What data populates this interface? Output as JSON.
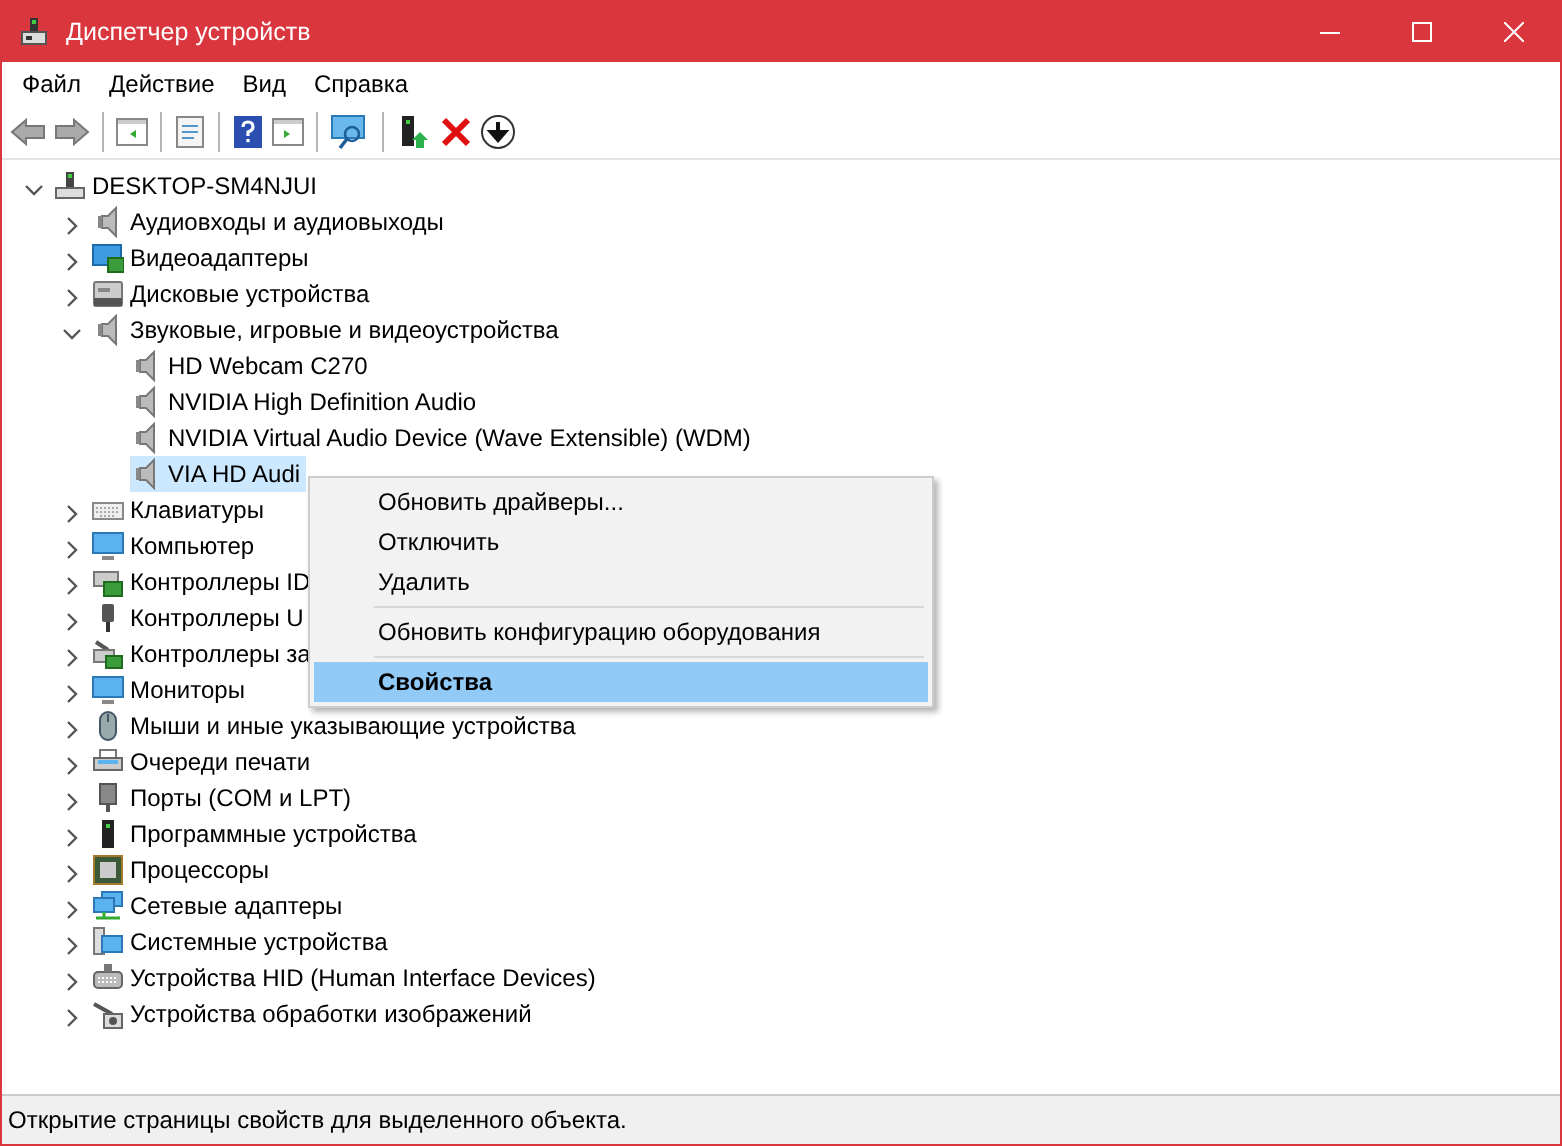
{
  "window": {
    "title": "Диспетчер устройств"
  },
  "menu_bar": [
    "Файл",
    "Действие",
    "Вид",
    "Справка"
  ],
  "tree": {
    "label": "DESKTOP-SM4NJUI",
    "kind": "computer",
    "expanded": true,
    "selected": false,
    "children": [
      {
        "label": "Аудиовходы и аудиовыходы",
        "kind": "speaker",
        "expanded": false,
        "selected": false
      },
      {
        "label": "Видеоадаптеры",
        "kind": "display",
        "expanded": false,
        "selected": false
      },
      {
        "label": "Дисковые устройства",
        "kind": "disk",
        "expanded": false,
        "selected": false
      },
      {
        "label": "Звуковые, игровые и видеоустройства",
        "kind": "speaker",
        "expanded": true,
        "selected": false,
        "children": [
          {
            "label": "HD Webcam C270",
            "kind": "speaker",
            "selected": false
          },
          {
            "label": "NVIDIA High Definition Audio",
            "kind": "speaker",
            "selected": false
          },
          {
            "label": "NVIDIA Virtual Audio Device (Wave Extensible) (WDM)",
            "kind": "speaker",
            "selected": false
          },
          {
            "label": "VIA HD Audi",
            "kind": "speaker",
            "selected": true
          }
        ]
      },
      {
        "label": "Клавиатуры",
        "kind": "keyboard",
        "expanded": false,
        "selected": false
      },
      {
        "label": "Компьютер",
        "kind": "monitor",
        "expanded": false,
        "selected": false
      },
      {
        "label": "Контроллеры ID",
        "kind": "controller",
        "expanded": false,
        "selected": false
      },
      {
        "label": "Контроллеры U",
        "kind": "usb",
        "expanded": false,
        "selected": false
      },
      {
        "label": "Контроллеры за",
        "kind": "storage",
        "expanded": false,
        "selected": false
      },
      {
        "label": "Мониторы",
        "kind": "monitor",
        "expanded": false,
        "selected": false
      },
      {
        "label": "Мыши и иные указывающие устройства",
        "kind": "mouse",
        "expanded": false,
        "selected": false
      },
      {
        "label": "Очереди печати",
        "kind": "printer",
        "expanded": false,
        "selected": false
      },
      {
        "label": "Порты (COM и LPT)",
        "kind": "port",
        "expanded": false,
        "selected": false
      },
      {
        "label": "Программные устройства",
        "kind": "software",
        "expanded": false,
        "selected": false
      },
      {
        "label": "Процессоры",
        "kind": "cpu",
        "expanded": false,
        "selected": false
      },
      {
        "label": "Сетевые адаптеры",
        "kind": "network",
        "expanded": false,
        "selected": false
      },
      {
        "label": "Системные устройства",
        "kind": "system",
        "expanded": false,
        "selected": false
      },
      {
        "label": "Устройства HID (Human Interface Devices)",
        "kind": "hid",
        "expanded": false,
        "selected": false
      },
      {
        "label": "Устройства обработки изображений",
        "kind": "camera",
        "expanded": false,
        "selected": false
      }
    ]
  },
  "context_menu": [
    {
      "kind": "item",
      "label": "Обновить драйверы...",
      "selected": false
    },
    {
      "kind": "item",
      "label": "Отключить",
      "selected": false
    },
    {
      "kind": "item",
      "label": "Удалить",
      "selected": false
    },
    {
      "kind": "separator"
    },
    {
      "kind": "item",
      "label": "Обновить конфигурацию оборудования",
      "selected": false
    },
    {
      "kind": "separator"
    },
    {
      "kind": "item",
      "label": "Свойства",
      "selected": true
    }
  ],
  "status_bar": "Открытие страницы свойств для выделенного объекта."
}
